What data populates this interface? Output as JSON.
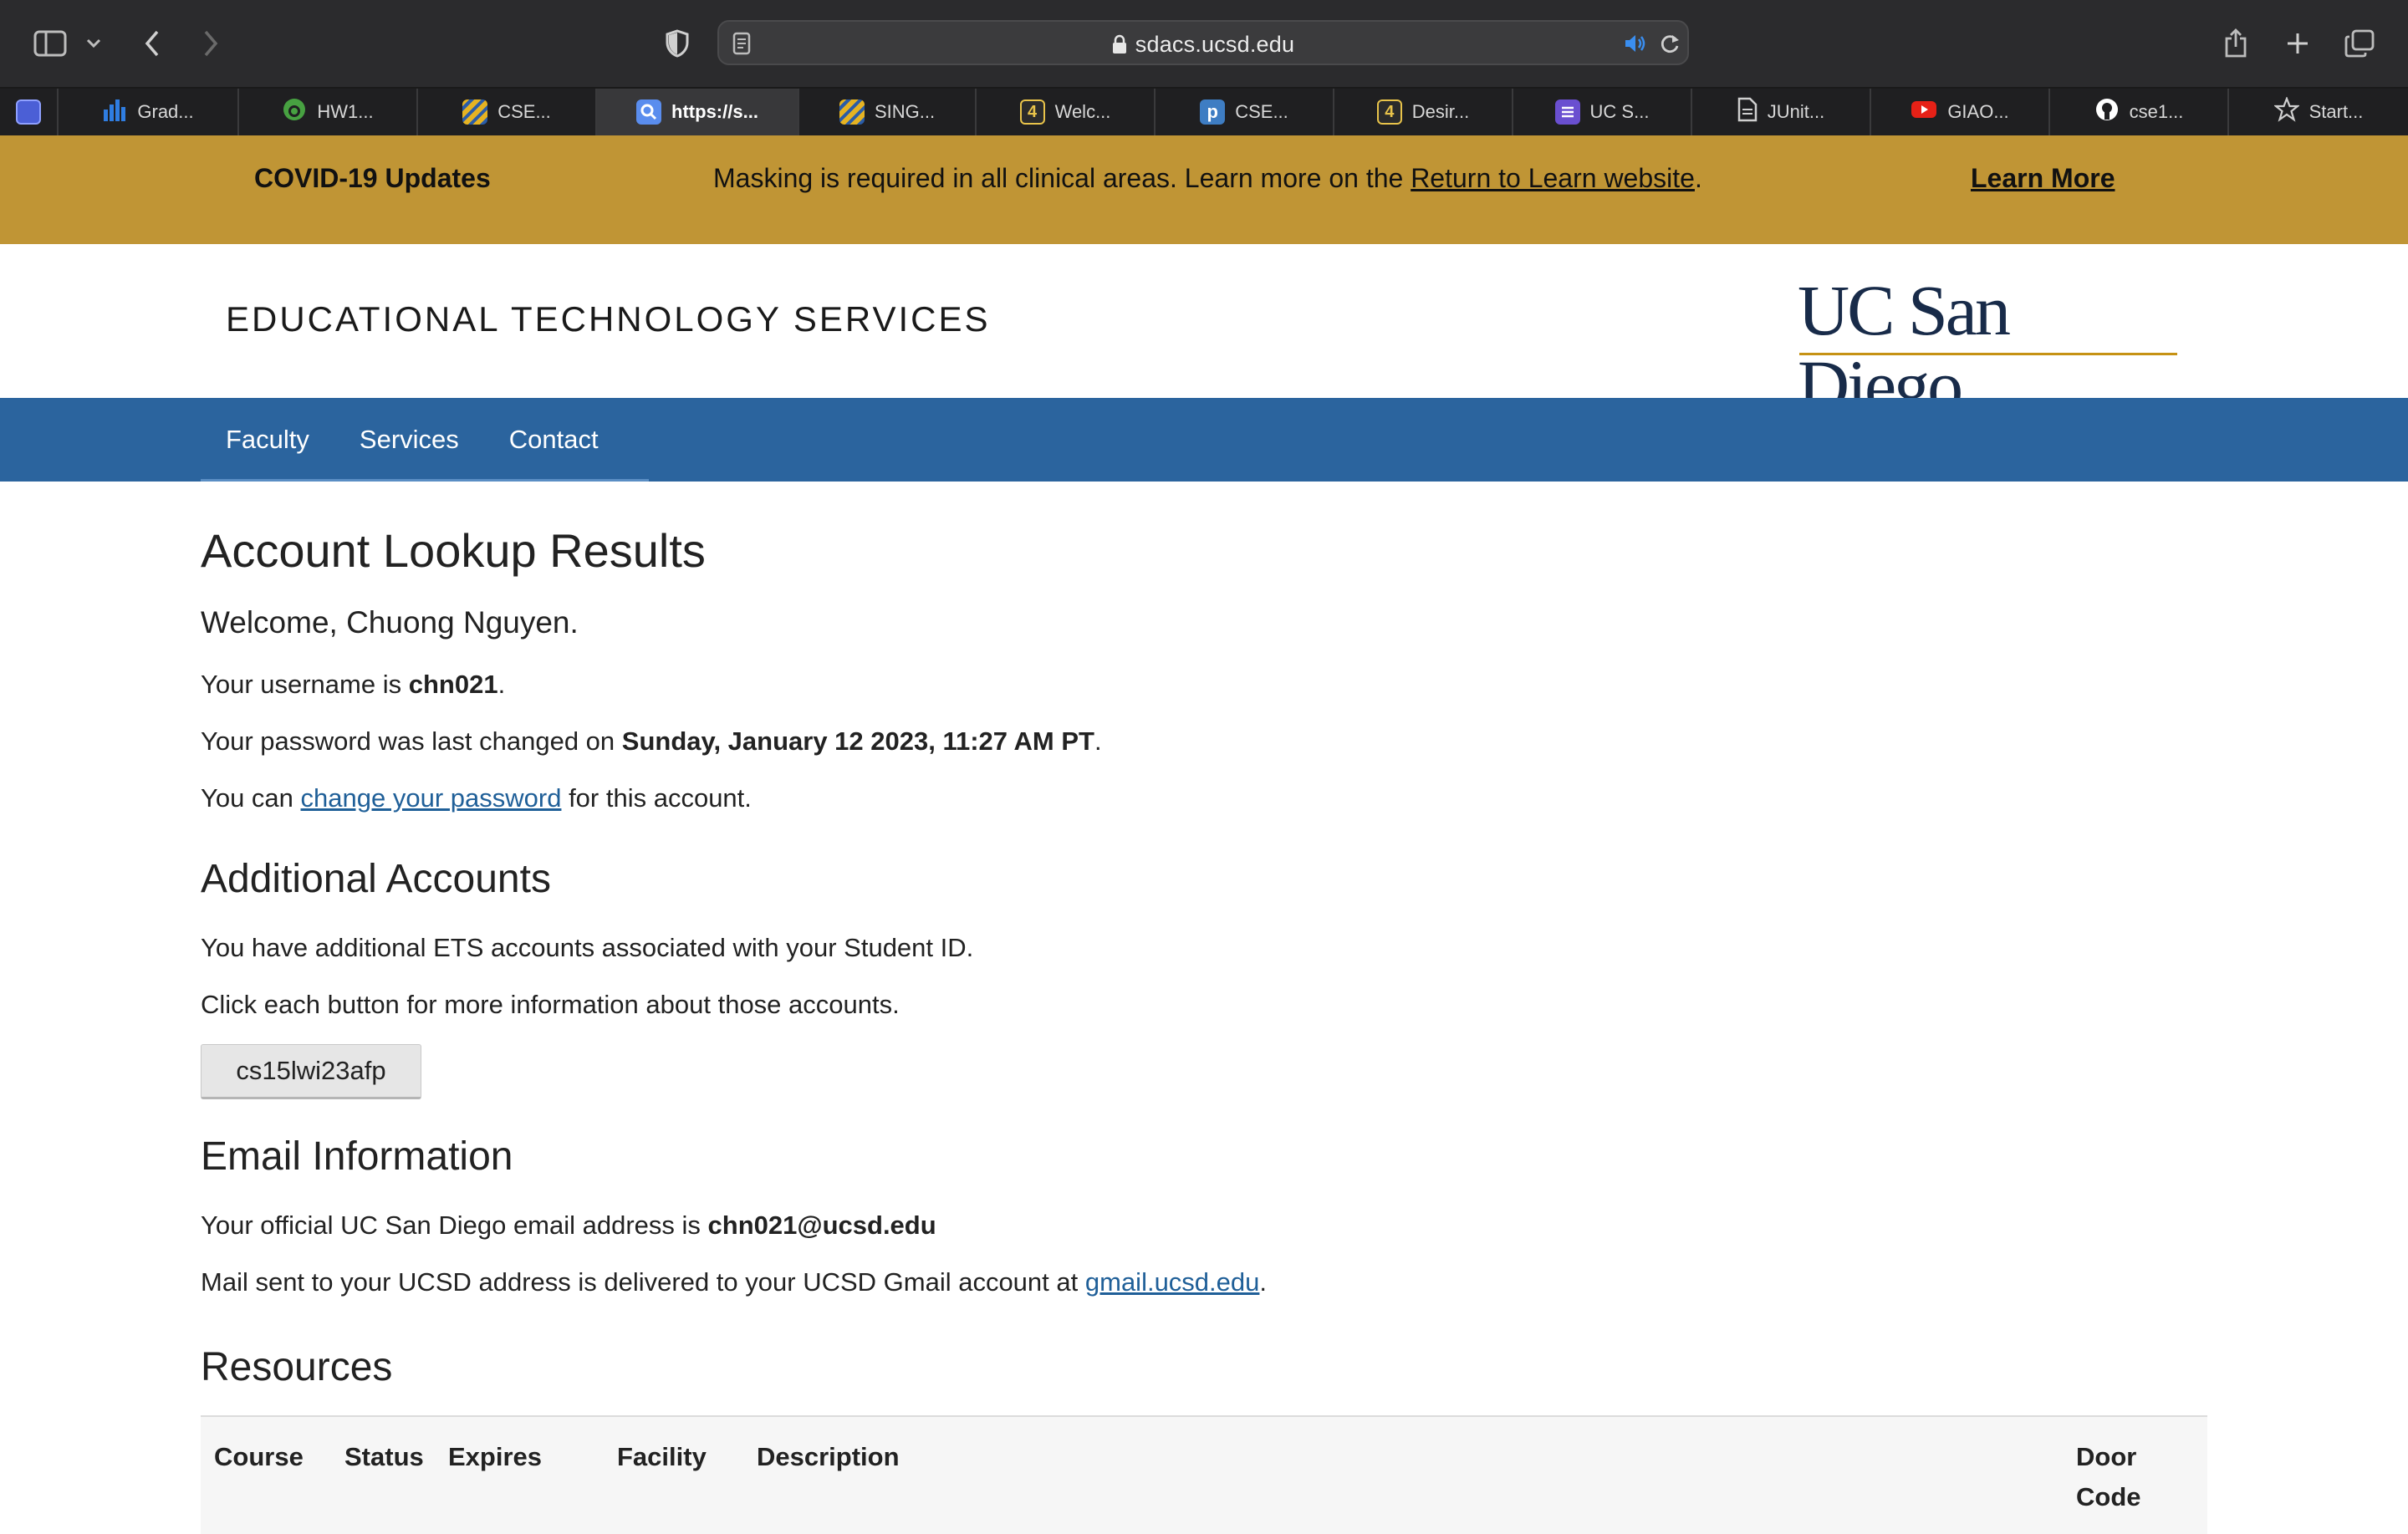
{
  "browser": {
    "address": "sdacs.ucsd.edu",
    "tabs": [
      {
        "label": "",
        "icon": "app-icon",
        "color": "#4b5fd6"
      },
      {
        "label": "Grad...",
        "icon": "bar-chart-icon",
        "color": "#2f7de1"
      },
      {
        "label": "HW1...",
        "icon": "overleaf-icon",
        "color": "#47a141"
      },
      {
        "label": "CSE...",
        "icon": "stripes-icon",
        "color": "#e5b323"
      },
      {
        "label": "https://s...",
        "icon": "search-icon",
        "color": "#5a8dee"
      },
      {
        "label": "SING...",
        "icon": "stripes-icon",
        "color": "#e5b323"
      },
      {
        "label": "Welc...",
        "icon": "four-e-icon",
        "color": "#e8c34a"
      },
      {
        "label": "CSE...",
        "icon": "piazza-icon",
        "color": "#3e7dc3"
      },
      {
        "label": "Desir...",
        "icon": "four-e-icon",
        "color": "#e8c34a"
      },
      {
        "label": "UC S...",
        "icon": "list-icon",
        "color": "#6a4fd0"
      },
      {
        "label": "JUnit...",
        "icon": "document-icon",
        "color": "#cfcfcf"
      },
      {
        "label": "GIAO...",
        "icon": "youtube-icon",
        "color": "#e62117"
      },
      {
        "label": "cse1...",
        "icon": "github-icon",
        "color": "#ffffff"
      },
      {
        "label": "Start...",
        "icon": "star-icon",
        "color": "#cfcfcf"
      }
    ]
  },
  "banner": {
    "title": "COVID-19 Updates",
    "message_prefix": "Masking is required in all clinical areas. Learn more on the ",
    "message_link": "Return to Learn website",
    "message_suffix": ".",
    "learn_more": "Learn More",
    "background": "#c09535"
  },
  "header": {
    "site_title": "EDUCATIONAL TECHNOLOGY SERVICES",
    "logo_text": "UC San Diego"
  },
  "nav": {
    "items": [
      "Faculty",
      "Services",
      "Contact"
    ],
    "background": "#2b649e"
  },
  "main": {
    "title": "Account Lookup Results",
    "welcome": "Welcome, Chuong Nguyen.",
    "username_prefix": "Your username is ",
    "username": "chn021",
    "username_suffix": ".",
    "pw_prefix": "Your password was last changed on ",
    "pw_date": "Sunday, January 12 2023, 11:27 AM PT",
    "pw_suffix": ".",
    "change_prefix": "You can ",
    "change_link": "change your password",
    "change_suffix": " for this account."
  },
  "additional": {
    "title": "Additional Accounts",
    "line1": "You have additional ETS accounts associated with your Student ID.",
    "line2": "Click each button for more information about those accounts.",
    "account_button": "cs15lwi23afp"
  },
  "email": {
    "title": "Email Information",
    "line1_prefix": "Your official UC San Diego email address is ",
    "address": "chn021@ucsd.edu",
    "line2_prefix": "Mail sent to your UCSD address is delivered to your UCSD Gmail account at ",
    "gmail_link": "gmail.ucsd.edu",
    "line2_suffix": "."
  },
  "resources": {
    "title": "Resources",
    "columns": [
      "Course",
      "Status",
      "Expires",
      "Facility",
      "Description",
      "Door Code"
    ]
  }
}
